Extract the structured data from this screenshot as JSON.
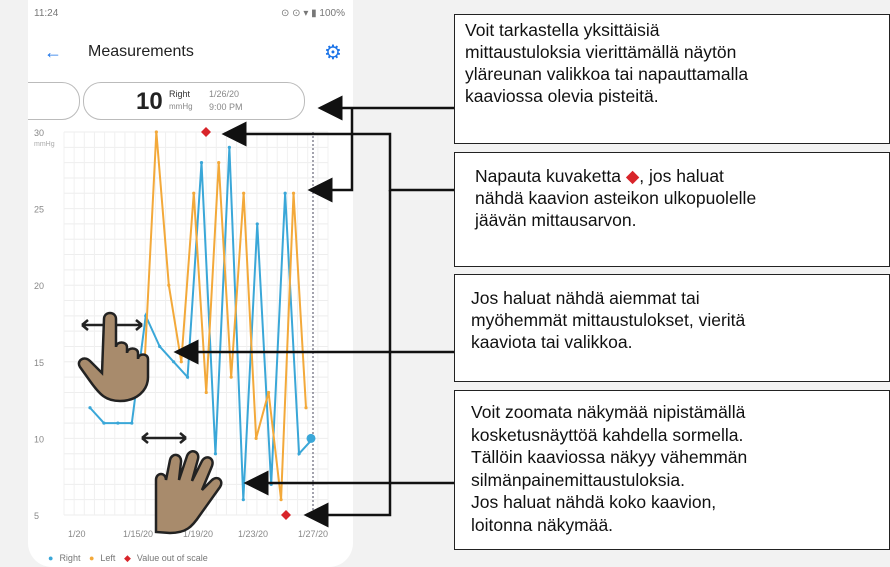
{
  "status_bar": {
    "time": "11:24",
    "icons": "⊙ ⊙ ▾ ▮ 100%"
  },
  "app_bar": {
    "title": "Measurements"
  },
  "current_measurement": {
    "value": "10",
    "eye": "Right",
    "unit": "mmHg",
    "date": "1/26/20",
    "time": "9:00 PM"
  },
  "chart_data": {
    "type": "line",
    "ylabel": "mmHg",
    "ylim": [
      5,
      30
    ],
    "yticks": [
      "30",
      "25",
      "20",
      "15",
      "10",
      "5"
    ],
    "xticks": [
      "1/20",
      "1/15/20",
      "1/19/20",
      "1/23/20",
      "1/27/20"
    ],
    "series": [
      {
        "name": "Right",
        "color": "#3aa7d8",
        "values": [
          12,
          11,
          11,
          11,
          18,
          16,
          15,
          14,
          28,
          9,
          29,
          6,
          24,
          7,
          26,
          9,
          10
        ]
      },
      {
        "name": "Left",
        "color": "#f3a93a",
        "values": [
          14,
          14,
          15,
          14,
          14,
          30,
          20,
          15,
          26,
          13,
          28,
          14,
          26,
          10,
          13,
          6,
          26,
          12
        ]
      }
    ],
    "out_of_scale_marks": [
      {
        "label": "top",
        "value": 30
      },
      {
        "label": "bottom",
        "value": 5
      }
    ]
  },
  "legend": {
    "right": "Right",
    "left": "Left",
    "out": "Value out of scale"
  },
  "callouts": [
    {
      "lines": [
        "Voit tarkastella yksittäisiä",
        "mittaustuloksia vierittämällä näytön",
        "yläreunan valikkoa tai napauttamalla",
        "kaaviossa olevia pisteitä."
      ]
    },
    {
      "pre": "Napauta kuvaketta",
      "post": ", jos haluat",
      "lines": [
        "nähdä kaavion asteikon ulkopuolelle",
        "jäävän mittausarvon."
      ]
    },
    {
      "lines": [
        "Jos haluat nähdä aiemmat tai",
        "myöhemmät mittaustulokset, vieritä",
        "kaaviota tai valikkoa."
      ]
    },
    {
      "lines": [
        "Voit zoomata näkymää nipistämällä",
        "kosketusnäyttöä kahdella sormella.",
        "Tällöin kaaviossa näkyy vähemmän",
        "silmänpainemittaustuloksia.",
        "Jos haluat nähdä koko kaavion,",
        "loitonna näkymää."
      ]
    }
  ],
  "colors": {
    "accent": "#1a73e8",
    "right": "#3aa7d8",
    "left": "#f3a93a",
    "out_of_scale": "#d8242a",
    "hand": "#a88b6c"
  }
}
